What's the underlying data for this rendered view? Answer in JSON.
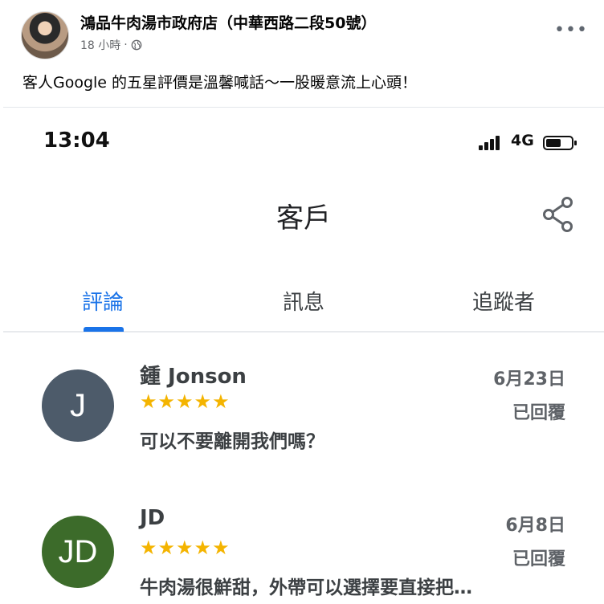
{
  "post": {
    "page_name": "鴻品牛肉湯市政府店（中華西路二段50號）",
    "time": "18 小時",
    "separator": "·",
    "more_icon": "more-horizontal-icon",
    "more_label": "•••",
    "text": "客人Google 的五星評價是溫馨喊話～一股暖意流上心頭！"
  },
  "phone": {
    "time": "13:04",
    "network": "4G",
    "title": "客戶",
    "tabs": [
      {
        "label": "評論",
        "active": true
      },
      {
        "label": "訊息",
        "active": false
      },
      {
        "label": "追蹤者",
        "active": false
      }
    ],
    "reviews": [
      {
        "initials": "J",
        "avatar_color": "#4d5b6a",
        "name": "鍾 Jonson",
        "date": "6月23日",
        "stars": "★★★★★",
        "rating": 5,
        "status": "已回覆",
        "text": "可以不要離開我們嗎？"
      },
      {
        "initials": "JD",
        "avatar_color": "#3c6b2a",
        "name": "JD",
        "date": "6月8日",
        "stars": "★★★★★",
        "rating": 5,
        "status": "已回覆",
        "text": "牛肉湯很鮮甜，外帶可以選擇要直接把…"
      }
    ]
  },
  "colors": {
    "accent": "#1a73e8",
    "star": "#f4b400"
  }
}
